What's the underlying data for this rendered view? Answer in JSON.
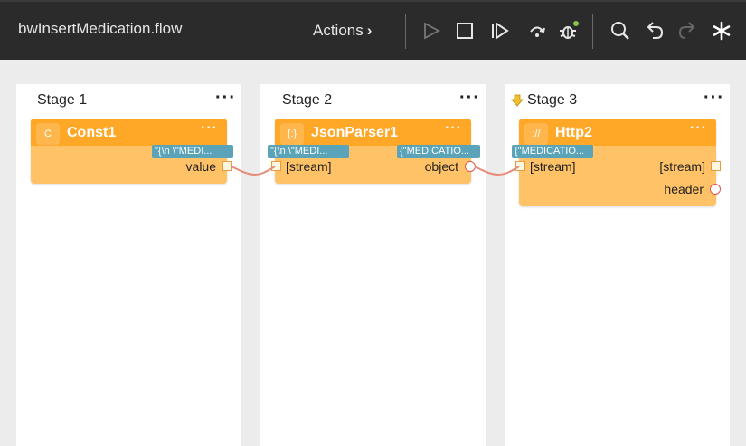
{
  "toolbar": {
    "flow_title": "bwInsertMedication.flow",
    "actions_label": "Actions",
    "status_dot_color": "#8bc34a"
  },
  "stages": [
    {
      "title": "Stage 1",
      "nodes": [
        {
          "icon_text": "C",
          "name": "Const1",
          "outputs": [
            "value"
          ],
          "tooltip": "\"{\\n \\\"MEDI..."
        }
      ]
    },
    {
      "title": "Stage 2",
      "nodes": [
        {
          "icon_text": "{:}",
          "name": "JsonParser1",
          "input": "[stream]",
          "outputs": [
            "object"
          ],
          "tooltip_in": "\"{\\n \\\"MEDI...",
          "tooltip_out": "{\"MEDICATIO..."
        }
      ]
    },
    {
      "title": "Stage 3",
      "nodes": [
        {
          "icon_text": "://",
          "name": "Http2",
          "input": "[stream]",
          "outputs": [
            "[stream]",
            "header"
          ],
          "tooltip_in": "{\"MEDICATIO..."
        }
      ]
    }
  ],
  "colors": {
    "node_header": "#ffa726",
    "node_body": "#ffc266",
    "tooltip": "#5ba3b8",
    "wire": "#e88b7a"
  }
}
